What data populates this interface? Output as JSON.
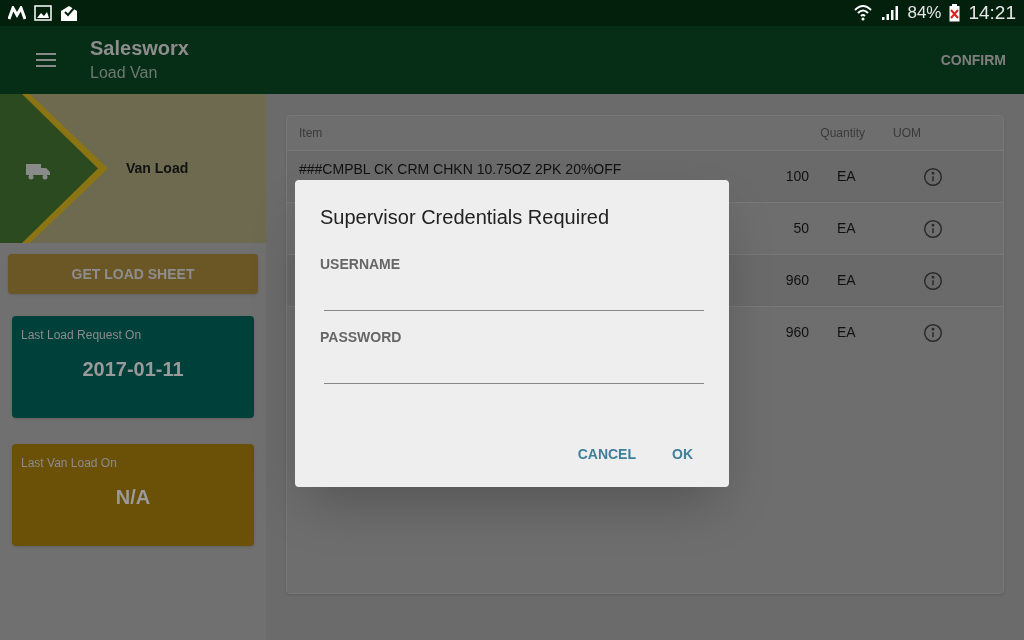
{
  "status_bar": {
    "battery": "84%",
    "time": "14:21"
  },
  "app_bar": {
    "title": "Salesworx",
    "subtitle": "Load Van",
    "action": "CONFIRM"
  },
  "banner": {
    "label": "Van Load"
  },
  "get_load_sheet": "GET LOAD SHEET",
  "cards": [
    {
      "label": "Last Load Request On",
      "value": "2017-01-11",
      "color": "#00403a"
    },
    {
      "label": "Last Van Load On",
      "value": "N/A",
      "color": "#6b5008"
    }
  ],
  "table": {
    "columns": [
      "Item",
      "Quantity",
      "UOM"
    ],
    "rows": [
      {
        "item": "###CMPBL CK CRM CHKN 10.75OZ 2PK 20%OFF",
        "quantity": "100",
        "uom": "EA"
      },
      {
        "quantity": "50",
        "uom": "EA"
      },
      {
        "quantity": "960",
        "uom": "EA"
      },
      {
        "quantity": "960",
        "uom": "EA"
      }
    ]
  },
  "dialog": {
    "title": "Supervisor Credentials Required",
    "fields": [
      {
        "label": "USERNAME"
      },
      {
        "label": "PASSWORD"
      }
    ],
    "buttons": [
      "CANCEL",
      "OK"
    ]
  }
}
